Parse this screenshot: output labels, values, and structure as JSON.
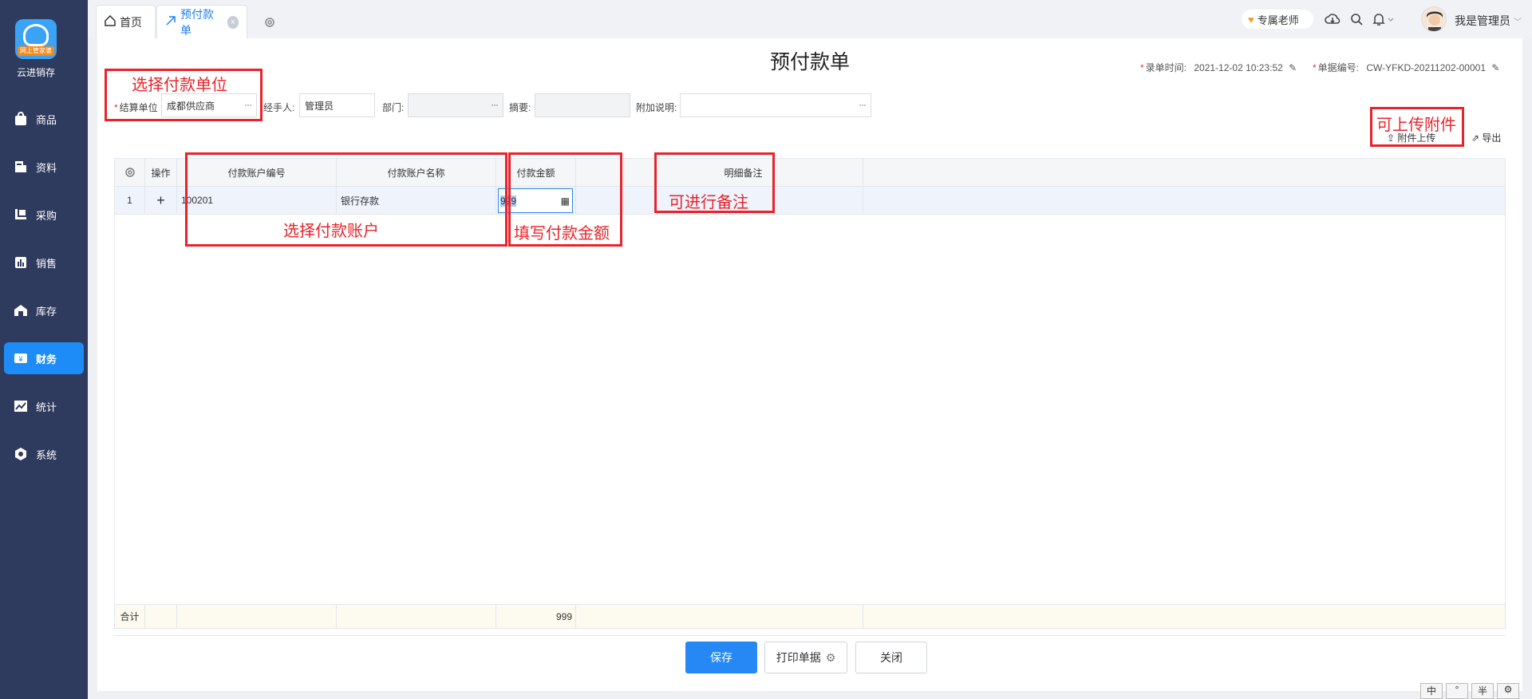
{
  "sidebar": {
    "brand": "云进销存",
    "logo_tag": "网上管家婆",
    "items": [
      {
        "label": "商品",
        "icon": "bag-icon"
      },
      {
        "label": "资料",
        "icon": "document-icon"
      },
      {
        "label": "采购",
        "icon": "purchase-icon"
      },
      {
        "label": "销售",
        "icon": "chart-icon"
      },
      {
        "label": "库存",
        "icon": "warehouse-icon"
      },
      {
        "label": "财务",
        "icon": "finance-icon"
      },
      {
        "label": "统计",
        "icon": "stats-icon"
      },
      {
        "label": "系统",
        "icon": "system-icon"
      }
    ],
    "active_index": 5
  },
  "tabs": {
    "home": "首页",
    "active": "预付款单",
    "close": "×"
  },
  "topbar": {
    "teacher": "专属老师",
    "user": "我是管理员"
  },
  "form": {
    "title": "预付款单",
    "entry_time_label": "录单时间:",
    "entry_time": "2021-12-02 10:23:52",
    "doc_no_label": "单据编号:",
    "doc_no": "CW-YFKD-20211202-00001",
    "settle_label": "结算单位",
    "settle_value": "成都供应商",
    "handler_label": "经手人:",
    "handler_value": "管理员",
    "dept_label": "部门:",
    "summary_label": "摘要:",
    "note_label": "附加说明:",
    "upload": "附件上传",
    "export": "导出",
    "dots": "···"
  },
  "table": {
    "headers": [
      "操作",
      "付款账户编号",
      "付款账户名称",
      "付款金额",
      "明细备注"
    ],
    "rows": [
      {
        "index": "1",
        "op": "+",
        "account_no": "100201",
        "account_name": "银行存款",
        "amount": "999"
      }
    ],
    "total_label": "合计",
    "total_amount": "999"
  },
  "buttons": {
    "save": "保存",
    "print": "打印单据",
    "close": "关闭"
  },
  "annotations": {
    "settle": "选择付款单位",
    "upload": "可上传附件",
    "account": "选择付款账户",
    "amount": "填写付款金额",
    "remark": "可进行备注"
  },
  "corner": [
    "中",
    "°",
    "半",
    "⚙"
  ],
  "colors": {
    "sidebar_bg": "#2f3b5e",
    "accent": "#1e8cf7",
    "annotation_red": "#e8232b"
  }
}
